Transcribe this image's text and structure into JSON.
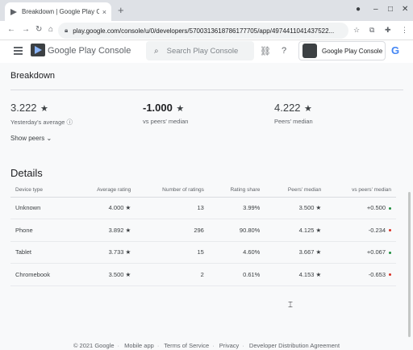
{
  "browser": {
    "tab_title": "Breakdown | Google Play Console",
    "tab_close": "×",
    "new_tab": "+",
    "url": "play.google.com/console/u/0/developers/5700313618786177705/app/4974411041437522..."
  },
  "header": {
    "app_name": "Google Play Console",
    "search_placeholder": "Search Play Console",
    "account_name": "Google Play Console",
    "google_letter": "G"
  },
  "breakdown": {
    "title": "Breakdown",
    "metrics": [
      {
        "value": "3.222",
        "label": "Yesterday's average"
      },
      {
        "value": "-1.000",
        "label": "vs peers' median"
      },
      {
        "value": "4.222",
        "label": "Peers' median"
      }
    ],
    "show_peers": "Show peers"
  },
  "details": {
    "title": "Details",
    "columns": [
      "Device type",
      "Average rating",
      "Number of ratings",
      "Rating share",
      "Peers' median",
      "vs peers' median"
    ],
    "rows": [
      {
        "device": "Unknown",
        "avg": "4.000",
        "count": "13",
        "share": "3.99%",
        "peers": "3.500",
        "vs": "+0.500",
        "vs_color": "#1e8e3e"
      },
      {
        "device": "Phone",
        "avg": "3.892",
        "count": "296",
        "share": "90.80%",
        "peers": "4.125",
        "vs": "-0.234",
        "vs_color": "#d93025"
      },
      {
        "device": "Tablet",
        "avg": "3.733",
        "count": "15",
        "share": "4.60%",
        "peers": "3.667",
        "vs": "+0.067",
        "vs_color": "#1e8e3e"
      },
      {
        "device": "Chromebook",
        "avg": "3.500",
        "count": "2",
        "share": "0.61%",
        "peers": "4.153",
        "vs": "-0.653",
        "vs_color": "#d93025"
      }
    ]
  },
  "footer": {
    "links": [
      "© 2021 Google",
      "Mobile app",
      "Terms of Service",
      "Privacy",
      "Developer Distribution Agreement"
    ]
  }
}
